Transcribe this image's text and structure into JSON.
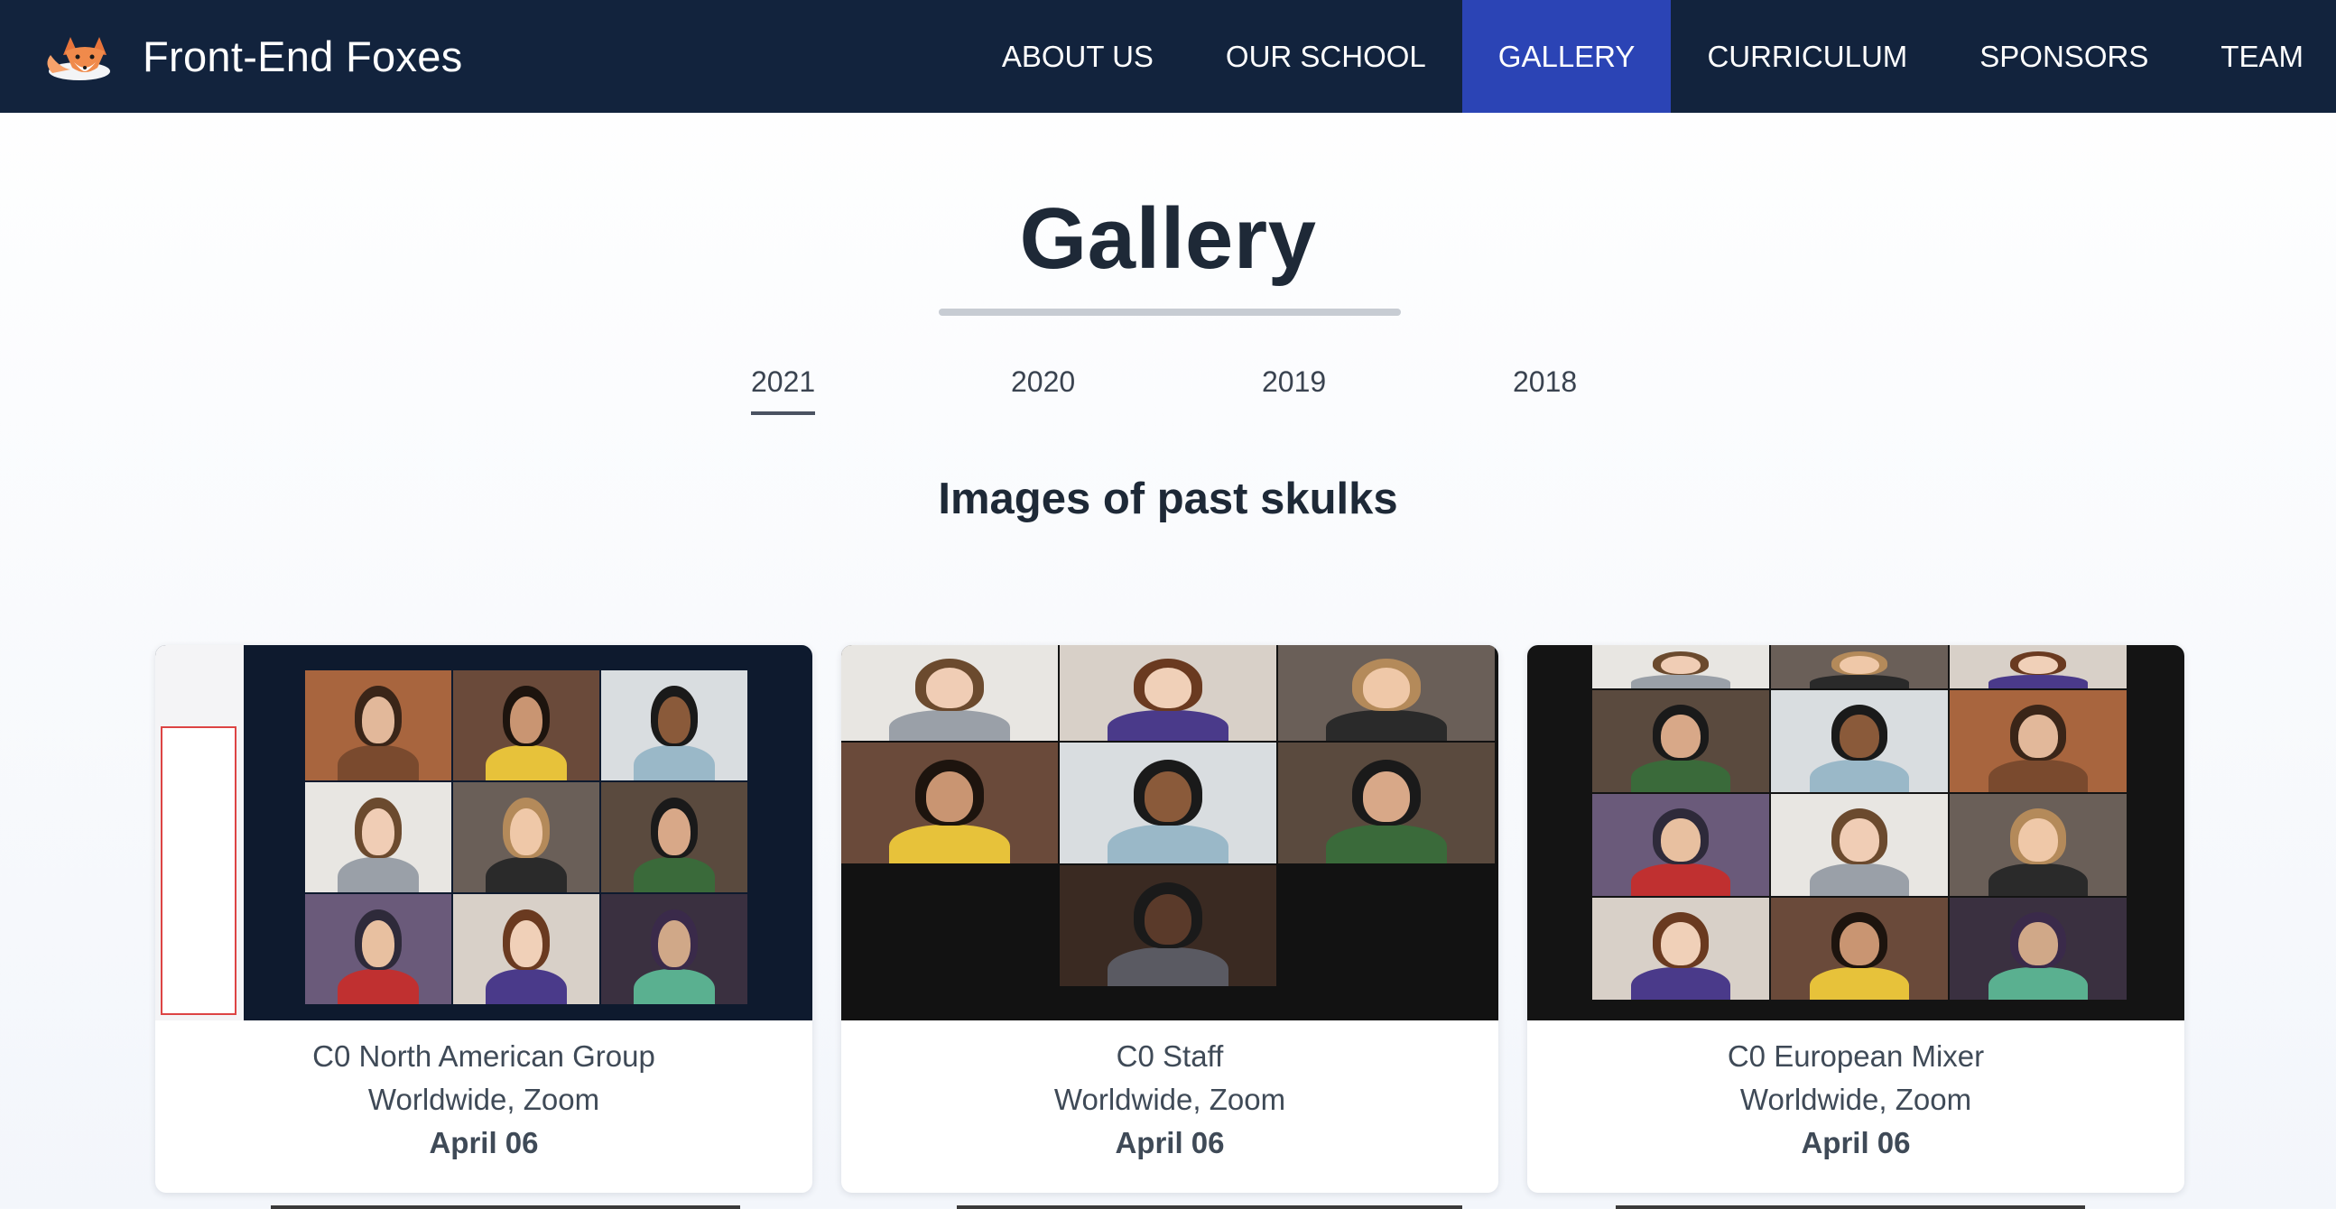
{
  "nav": {
    "brand": "Front-End Foxes",
    "links": [
      "ABOUT US",
      "OUR SCHOOL",
      "GALLERY",
      "CURRICULUM",
      "SPONSORS",
      "TEAM"
    ],
    "active": "GALLERY"
  },
  "gallery": {
    "title": "Gallery",
    "years": [
      "2021",
      "2020",
      "2019",
      "2018"
    ],
    "active_year": "2021",
    "section_title": "Images of past skulks"
  },
  "cards": [
    {
      "title": "C0 North American Group",
      "location": "Worldwide, Zoom",
      "date": "April 06"
    },
    {
      "title": "C0 Staff",
      "location": "Worldwide, Zoom",
      "date": "April 06"
    },
    {
      "title": "C0 European Mixer",
      "location": "Worldwide, Zoom",
      "date": "April 06"
    }
  ],
  "colors": {
    "nav_bg": "#12233d",
    "nav_active": "#2b44b5",
    "text_dark": "#1e2937"
  }
}
